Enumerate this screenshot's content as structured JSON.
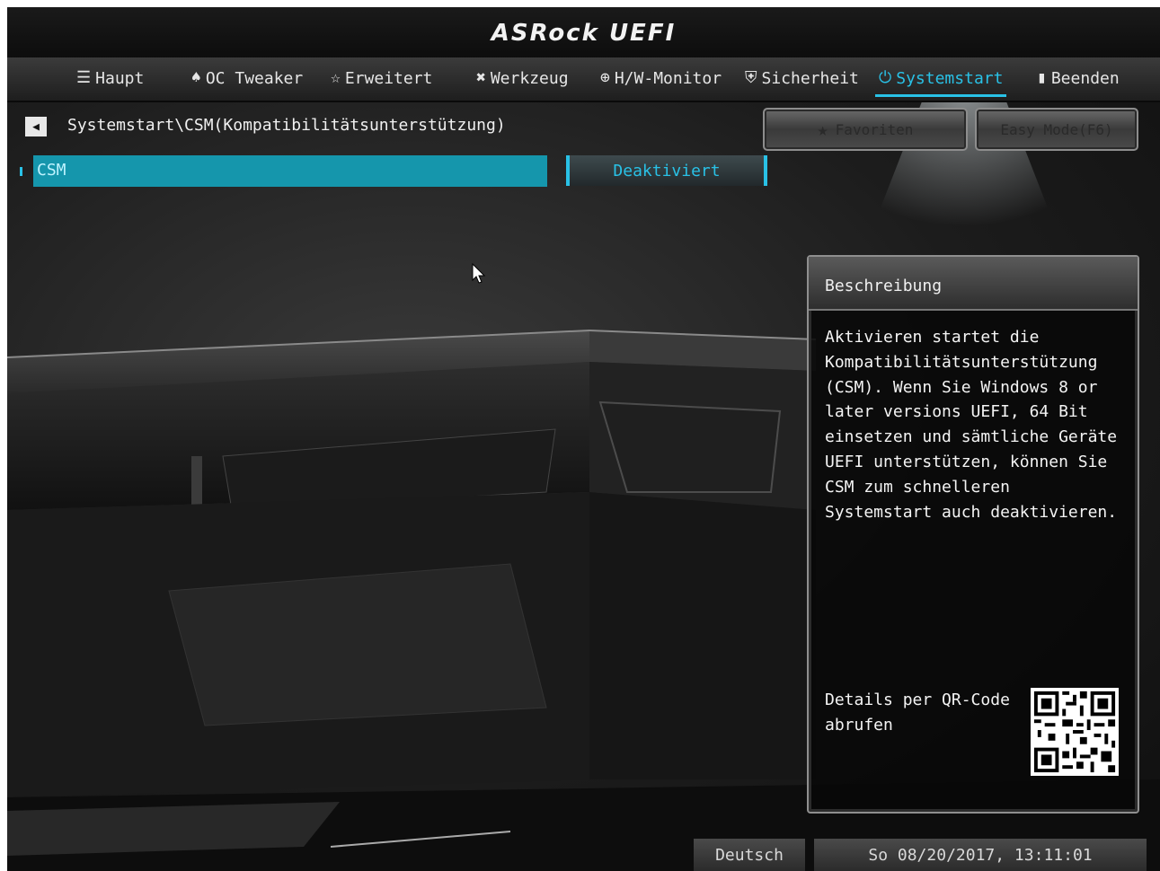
{
  "brand": "ASRock UEFI",
  "tabs": [
    {
      "label": "Haupt",
      "icon": "list-icon",
      "glyph": "☰",
      "active": false
    },
    {
      "label": "OC Tweaker",
      "icon": "rocket-icon",
      "glyph": "♠",
      "active": false
    },
    {
      "label": "Erweitert",
      "icon": "star-outline-icon",
      "glyph": "☆",
      "active": false
    },
    {
      "label": "Werkzeug",
      "icon": "tools-icon",
      "glyph": "✖",
      "active": false
    },
    {
      "label": "H/W-Monitor",
      "icon": "monitor-gauge-icon",
      "glyph": "⊕",
      "active": false
    },
    {
      "label": "Sicherheit",
      "icon": "shield-icon",
      "glyph": "⛨",
      "active": false
    },
    {
      "label": "Systemstart",
      "icon": "power-icon",
      "glyph": "⏻",
      "active": true
    },
    {
      "label": "Beenden",
      "icon": "exit-door-icon",
      "glyph": "▮",
      "active": false
    }
  ],
  "breadcrumb": "Systemstart\\CSM(Kompatibilitätsunterstützung)",
  "buttons": {
    "favoriten": "Favoriten",
    "easy_mode": "Easy Mode(F6)"
  },
  "setting": {
    "label": "CSM",
    "value": "Deaktiviert"
  },
  "description": {
    "title": "Beschreibung",
    "text": "Aktivieren startet die Kompatibilitätsunterstützung (CSM). Wenn Sie Windows 8 or later versions UEFI, 64 Bit einsetzen und sämtliche Geräte UEFI unterstützen, können Sie CSM zum schnelleren Systemstart auch deaktivieren.",
    "qr_text": "Details per QR-Code abrufen"
  },
  "status": {
    "language": "Deutsch",
    "datetime": "So 08/20/2017, 13:11:01"
  },
  "colors": {
    "accent": "#29c1e6",
    "highlight_row": "#1596ac"
  }
}
